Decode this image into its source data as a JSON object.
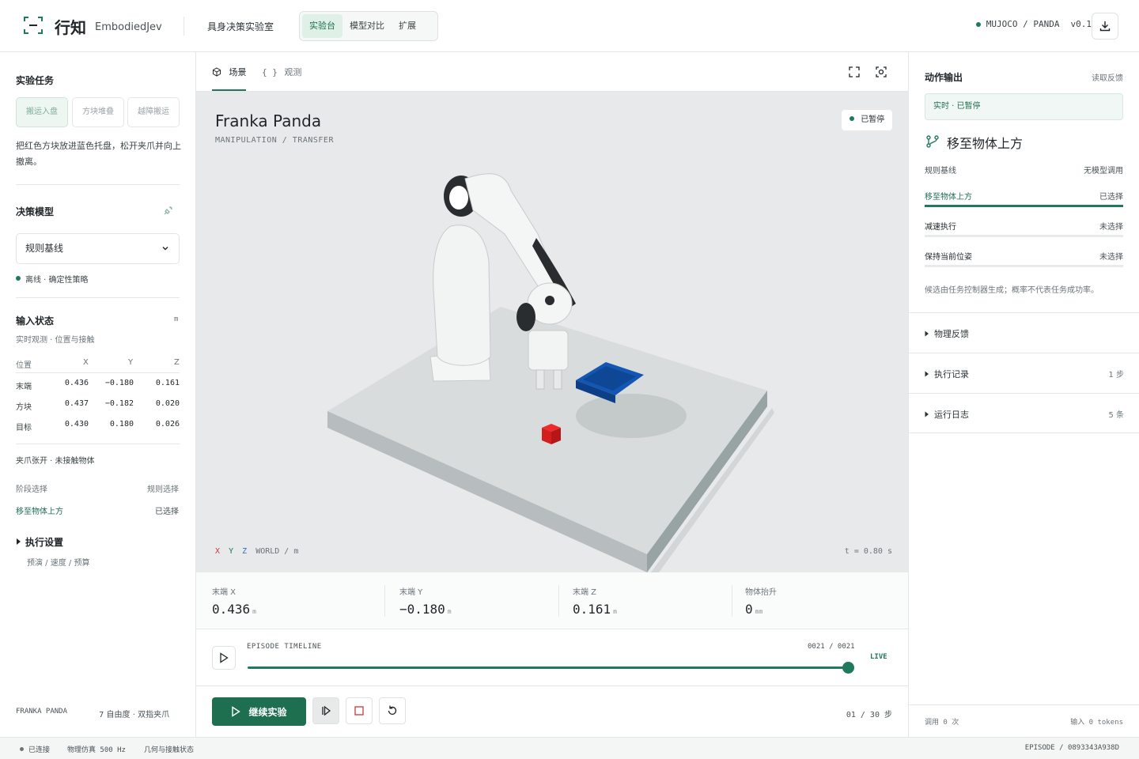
{
  "header": {
    "brand_name": "行知",
    "brand_sub": "EmbodiedJev",
    "lab_name": "具身决策实验室",
    "nav_tabs": [
      "实验台",
      "模型对比",
      "扩展"
    ],
    "active_tab": "实验台",
    "engine": "MUJOCO / PANDA",
    "version": "v0.1",
    "status_color": "#1e7a59"
  },
  "left": {
    "task_title": "实验任务",
    "tasks": [
      "搬运入盘",
      "方块堆叠",
      "越障搬运"
    ],
    "active_task": "搬运入盘",
    "task_desc": "把红色方块放进蓝色托盘，松开夹爪并向上撤离。",
    "model_title": "决策模型",
    "model_select": "规则基线",
    "model_note": "离线 · 确定性策略",
    "input_title": "输入状态",
    "input_unit": "m",
    "input_sub": "实时观测 · 位置与接触",
    "table": {
      "headers": [
        "位置",
        "X",
        "Y",
        "Z"
      ],
      "rows": [
        {
          "label": "末端",
          "x": "0.436",
          "y": "−0.180",
          "z": "0.161"
        },
        {
          "label": "方块",
          "x": "0.437",
          "y": "−0.182",
          "z": "0.020"
        },
        {
          "label": "目标",
          "x": "0.430",
          "y": "0.180",
          "z": "0.026"
        }
      ]
    },
    "gripper_state": "夹爪张开 · 未接触物体",
    "phase_label": "阶段选择",
    "phase_source": "规则选择",
    "phase_value": "移至物体上方",
    "phase_state": "已选择",
    "exec_title": "执行设置",
    "exec_sub": "预演 / 速度 / 预算",
    "footer_robot": "FRANKA PANDA",
    "footer_dof": "7 自由度 · 双指夹爪"
  },
  "center": {
    "tabs": [
      "场景",
      "观测"
    ],
    "active_tab": "场景",
    "scene_title": "Franka Panda",
    "scene_sub": "MANIPULATION / TRANSFER",
    "paused_badge": "已暂停",
    "axes_x": "X",
    "axes_y": "Y",
    "axes_z": "Z",
    "axes_world": "WORLD / m",
    "time_readout": "t = 0.80 s",
    "metrics": [
      {
        "label": "末端 X",
        "value": "0.436",
        "unit": "m"
      },
      {
        "label": "末端 Y",
        "value": "−0.180",
        "unit": "m"
      },
      {
        "label": "末端 Z",
        "value": "0.161",
        "unit": "m"
      },
      {
        "label": "物体抬升",
        "value": "0",
        "unit": "mm"
      }
    ],
    "timeline_label": "EPISODE TIMELINE",
    "timeline_count": "0021 / 0021",
    "timeline_progress": 1.0,
    "live": "LIVE",
    "primary_button": "继续实验",
    "steps": "01 / 30 步"
  },
  "right": {
    "title": "动作输出",
    "link": "读取反馈",
    "status": "实时 · 已暂停",
    "action": "移至物体上方",
    "source_label": "规则基线",
    "source_note": "无模型调用",
    "options": [
      {
        "label": "移至物体上方",
        "state": "已选择",
        "selected": true
      },
      {
        "label": "减速执行",
        "state": "未选择",
        "selected": false
      },
      {
        "label": "保持当前位姿",
        "state": "未选择",
        "selected": false
      }
    ],
    "note": "候选由任务控制器生成；概率不代表任务成功率。",
    "collapsibles": [
      {
        "label": "物理反馈",
        "count": ""
      },
      {
        "label": "执行记录",
        "count": "1 步"
      },
      {
        "label": "运行日志",
        "count": "5 条"
      }
    ],
    "footer_calls": "调用 0 次",
    "footer_tokens": "输入 0 tokens"
  },
  "statusbar": {
    "connected": "已连接",
    "sim": "物理仿真 500 Hz",
    "geom": "几何与接触状态",
    "episode": "EPISODE / 0893343A938D"
  }
}
